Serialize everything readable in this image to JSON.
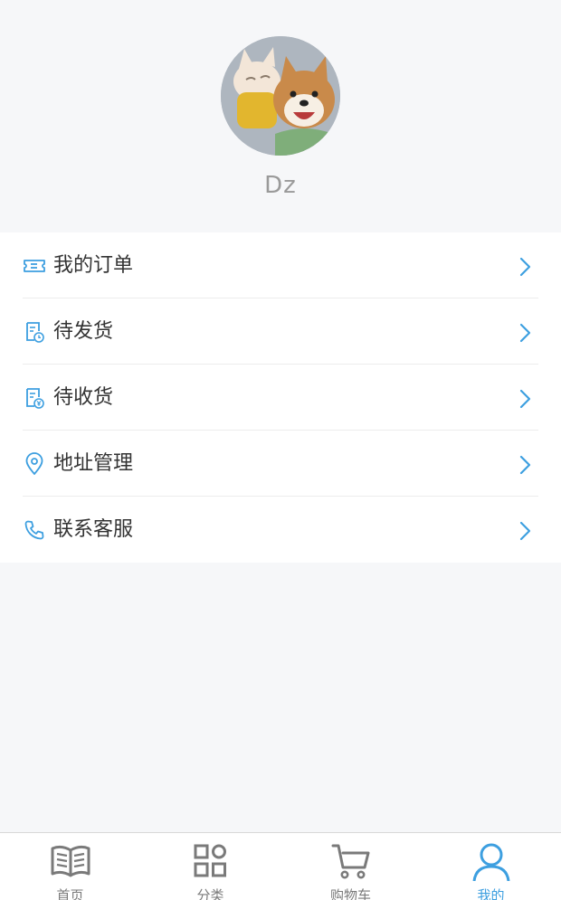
{
  "profile": {
    "username": "Dz",
    "avatar_icon": "avatar-photo-cat-and-dog"
  },
  "menu": {
    "accent_color": "#3d9fe0",
    "items": [
      {
        "label": "我的订单",
        "icon": "ticket-icon"
      },
      {
        "label": "待发货",
        "icon": "document-clock-icon"
      },
      {
        "label": "待收货",
        "icon": "document-yen-icon"
      },
      {
        "label": "地址管理",
        "icon": "location-pin-icon"
      },
      {
        "label": "联系客服",
        "icon": "phone-icon"
      }
    ]
  },
  "tabbar": {
    "active_color": "#3d9fe0",
    "inactive_color": "#7a7a7a",
    "tabs": [
      {
        "label": "首页",
        "icon": "book-icon",
        "active": false
      },
      {
        "label": "分类",
        "icon": "category-grid-icon",
        "active": false
      },
      {
        "label": "购物车",
        "icon": "cart-icon",
        "active": false
      },
      {
        "label": "我的",
        "icon": "user-icon",
        "active": true
      }
    ]
  }
}
